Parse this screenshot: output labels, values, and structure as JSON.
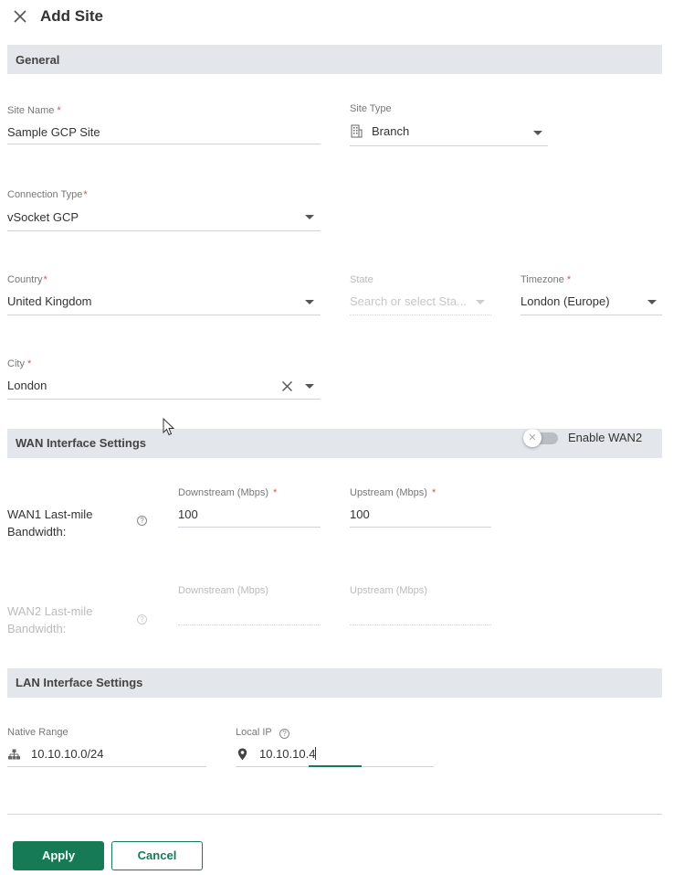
{
  "header": {
    "title": "Add Site",
    "close_icon": "close-icon"
  },
  "sections": {
    "general": "General",
    "wan": "WAN Interface Settings",
    "lan": "LAN Interface Settings"
  },
  "general": {
    "site_name": {
      "label": "Site Name",
      "required": "*",
      "value": "Sample GCP Site"
    },
    "site_type": {
      "label": "Site Type",
      "value": "Branch",
      "icon": "building-icon"
    },
    "connection_type": {
      "label": "Connection Type",
      "required": "*",
      "value": "vSocket GCP"
    },
    "country": {
      "label": "Country",
      "required": "*",
      "value": "United Kingdom"
    },
    "state": {
      "label": "State",
      "placeholder": "Search or select Sta..."
    },
    "timezone": {
      "label": "Timezone",
      "required": "*",
      "value": "London (Europe)"
    },
    "city": {
      "label": "City",
      "required": "*",
      "value": "London"
    }
  },
  "wan": {
    "enable_wan2": {
      "label": "Enable WAN2",
      "enabled": false
    },
    "wan1": {
      "label_line1": "WAN1 Last-mile",
      "label_line2": "Bandwidth:",
      "downstream": {
        "label": "Downstream (Mbps)",
        "required": "*",
        "value": "100"
      },
      "upstream": {
        "label": "Upstream (Mbps)",
        "required": "*",
        "value": "100"
      }
    },
    "wan2": {
      "label_line1": "WAN2 Last-mile",
      "label_line2": "Bandwidth:",
      "downstream": {
        "label": "Downstream (Mbps)",
        "value": ""
      },
      "upstream": {
        "label": "Upstream (Mbps)",
        "value": ""
      }
    }
  },
  "lan": {
    "native_range": {
      "label": "Native Range",
      "value": "10.10.10.0/24",
      "icon": "network-icon"
    },
    "local_ip": {
      "label": "Local IP",
      "value": "10.10.10.4",
      "icon": "location-pin-icon"
    }
  },
  "footer": {
    "apply": "Apply",
    "cancel": "Cancel"
  },
  "colors": {
    "accent": "#177a56",
    "section_bg": "#e3e7ec",
    "required": "#d9534f"
  }
}
